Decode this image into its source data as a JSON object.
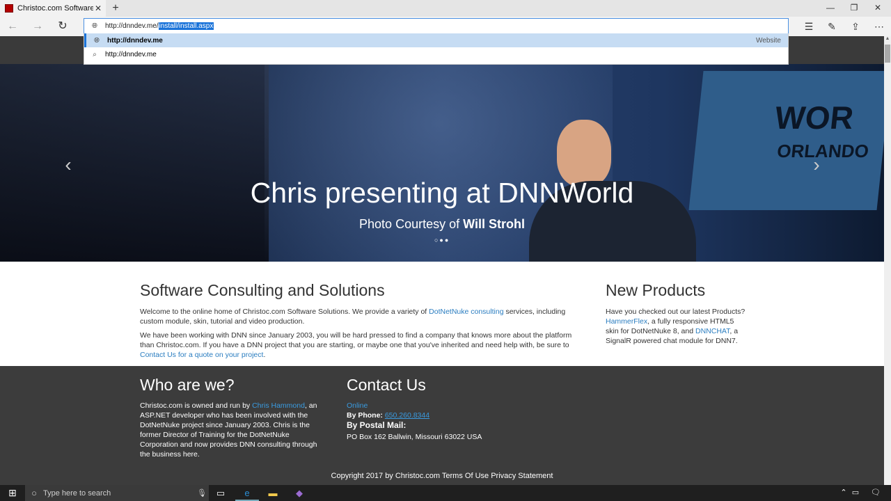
{
  "browser": {
    "tab_title": "Christoc.com Software S",
    "tab_close": "✕",
    "new_tab": "+",
    "url_prefix": "http://dnndev.me/",
    "url_selected": "install/install.aspx",
    "suggestions": [
      {
        "text": "http://dnndev.me",
        "type": "Website",
        "icon": "globe-icon"
      },
      {
        "text": "http://dnndev.me",
        "type": "",
        "icon": "search-icon"
      }
    ]
  },
  "hero": {
    "caption": "Chris presenting at DNNWorld",
    "sub_prefix": "Photo Courtesy of ",
    "sub_name": "Will Strohl",
    "banner_line1": "WOR",
    "banner_line2": "ORLANDO",
    "dots": "○●●"
  },
  "main": {
    "title": "Software Consulting and Solutions",
    "p1_a": "Welcome to the online home of Christoc.com Software Solutions. We provide a variety of ",
    "p1_link": "DotNetNuke consulting",
    "p1_b": " services, including custom module, skin, tutorial and video production.",
    "p2_a": "We have been working with DNN since January 2003, you will be hard pressed to find a company that knows more about the platform than Christoc.com. If you have a DNN project that you are starting, or maybe one that you've inherited and need help with, be sure to ",
    "p2_link": "Contact Us for a quote on your project",
    "p2_b": "."
  },
  "products": {
    "title": "New Products",
    "text_a": "Have you checked out our latest Products? ",
    "link1": "HammerFlex",
    "text_b": ", a fully responsive HTML5 skin for DotNetNuke 8, and ",
    "link2": "DNNCHAT",
    "text_c": ", a SignalR powered chat module for DNN7."
  },
  "who": {
    "title": "Who are we?",
    "text_a": "Christoc.com is owned and run by ",
    "link": "Chris Hammond",
    "text_b": ", an ASP.NET developer who has been involved with the DotNetNuke project since January 2003. Chris is the former Director of Training for the DotNetNuke Corporation and now provides DNN consulting through the business here."
  },
  "contact": {
    "title": "Contact Us",
    "online": "Online",
    "phone_label": "By Phone: ",
    "phone": "650.260.8344",
    "postal_label": "By Postal Mail:",
    "address": "PO Box 162 Ballwin, Missouri 63022 USA"
  },
  "footer": {
    "copyright": "Copyright 2017 by Christoc.com Terms Of Use Privacy Statement"
  },
  "taskbar": {
    "search_placeholder": "Type here to search"
  }
}
